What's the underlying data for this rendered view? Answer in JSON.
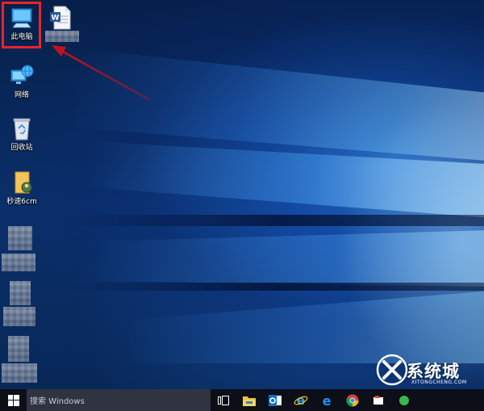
{
  "desktop": {
    "icons": [
      {
        "label": "此电脑",
        "icon": "this-pc-icon"
      },
      {
        "label": "",
        "icon": "word-document-icon"
      },
      {
        "label": "网络",
        "icon": "network-icon"
      },
      {
        "label": "回收站",
        "icon": "recycle-bin-icon"
      },
      {
        "label": "秒速6cm",
        "icon": "media-file-icon"
      },
      {
        "label": "",
        "icon": "blurred-file-icon"
      },
      {
        "label": "",
        "icon": "blurred-file-icon"
      },
      {
        "label": "",
        "icon": "blurred-file-icon"
      }
    ],
    "highlight_color": "#e8242b",
    "arrow_color": "#c0141c"
  },
  "taskbar": {
    "search_placeholder": "搜索 Windows",
    "apps": [
      {
        "name": "task-view-icon"
      },
      {
        "name": "file-explorer-icon"
      },
      {
        "name": "outlook-icon"
      },
      {
        "name": "internet-explorer-icon"
      },
      {
        "name": "edge-icon"
      },
      {
        "name": "chrome-icon"
      },
      {
        "name": "app-icon"
      },
      {
        "name": "app-icon"
      }
    ]
  },
  "watermark": {
    "brand": "系统城",
    "url": "XITONGCHENG.COM",
    "logo_letter": "X"
  },
  "colors": {
    "taskbar_bg": "#0c0f17",
    "search_bg": "#2f3440",
    "accent_blue": "#1e90ff"
  }
}
